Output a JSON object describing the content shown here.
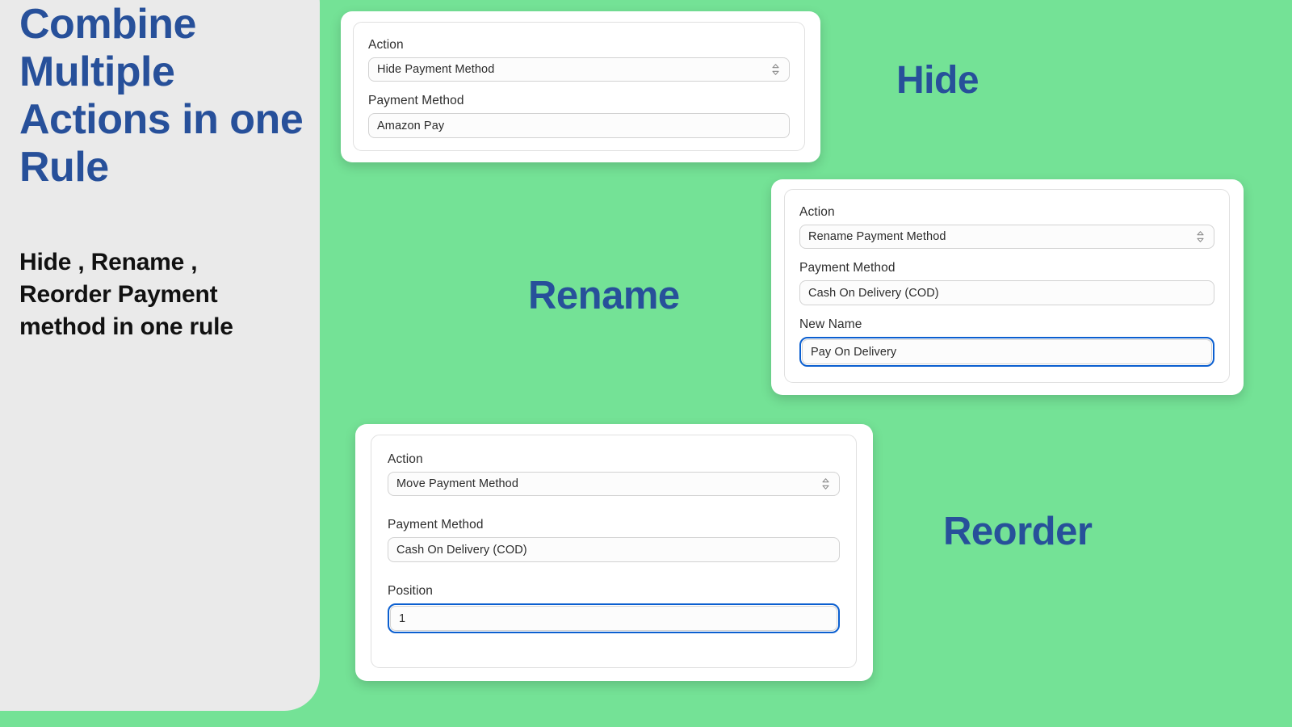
{
  "theme": {
    "background_green": "#74E296",
    "panel_gray": "#EAEAEA",
    "accent_blue": "#27509A",
    "focus_blue": "#0B5FD0",
    "card_white": "#FFFFFF",
    "label_text": "#2E2E2E"
  },
  "left_panel": {
    "title": "Combine Multiple Actions in one Rule",
    "subtitle": "Hide , Rename , Reorder Payment method in one rule"
  },
  "section_labels": {
    "hide": "Hide",
    "rename": "Rename",
    "reorder": "Reorder"
  },
  "cards": [
    {
      "id": "hide",
      "fields": [
        {
          "label": "Action",
          "type": "select",
          "value": "Hide Payment Method",
          "icon": "chevron-updown-icon",
          "focused": false
        },
        {
          "label": "Payment Method",
          "type": "text",
          "value": "Amazon Pay",
          "focused": false
        }
      ]
    },
    {
      "id": "rename",
      "fields": [
        {
          "label": "Action",
          "type": "select",
          "value": "Rename Payment Method",
          "icon": "chevron-updown-icon",
          "focused": false
        },
        {
          "label": "Payment Method",
          "type": "text",
          "value": "Cash On Delivery (COD)",
          "focused": false
        },
        {
          "label": "New Name",
          "type": "text",
          "value": "Pay On Delivery",
          "focused": true
        }
      ]
    },
    {
      "id": "move",
      "fields": [
        {
          "label": "Action",
          "type": "select",
          "value": "Move Payment Method",
          "icon": "chevron-updown-icon",
          "focused": false
        },
        {
          "label": "Payment Method",
          "type": "text",
          "value": "Cash On Delivery (COD)",
          "focused": false
        },
        {
          "label": "Position",
          "type": "text",
          "value": "1",
          "focused": true
        }
      ]
    }
  ]
}
